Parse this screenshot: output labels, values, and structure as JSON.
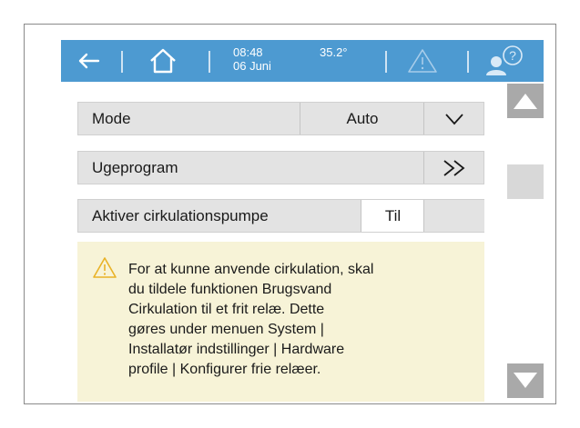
{
  "topbar": {
    "back_icon": "back-arrow-icon",
    "home_icon": "home-icon",
    "time": "08:48",
    "date": "06 Juni",
    "temperature": "35.2°",
    "warning_icon": "warning-icon",
    "help_icon": "user-help-icon",
    "bar_color": "#4d9ad1"
  },
  "rows": {
    "mode": {
      "label": "Mode",
      "value": "Auto",
      "action_icon": "chevron-down-icon"
    },
    "ugeprogram": {
      "label": "Ugeprogram",
      "action_icon": "double-chevron-right-icon"
    },
    "cirkulation": {
      "label": "Aktiver cirkulationspumpe",
      "value": "Til"
    }
  },
  "notice": {
    "icon": "warning-icon",
    "lines": [
      "For at kunne anvende cirkulation, skal",
      "du tildele funktionen Brugsvand",
      "Cirkulation til et frit relæ. Dette",
      "gøres under menuen System |",
      "Installatør indstillinger | Hardware",
      "profile | Konfigurer frie relæer."
    ]
  },
  "scrollbar": {
    "up_icon": "triangle-up-icon",
    "down_icon": "triangle-down-icon"
  }
}
